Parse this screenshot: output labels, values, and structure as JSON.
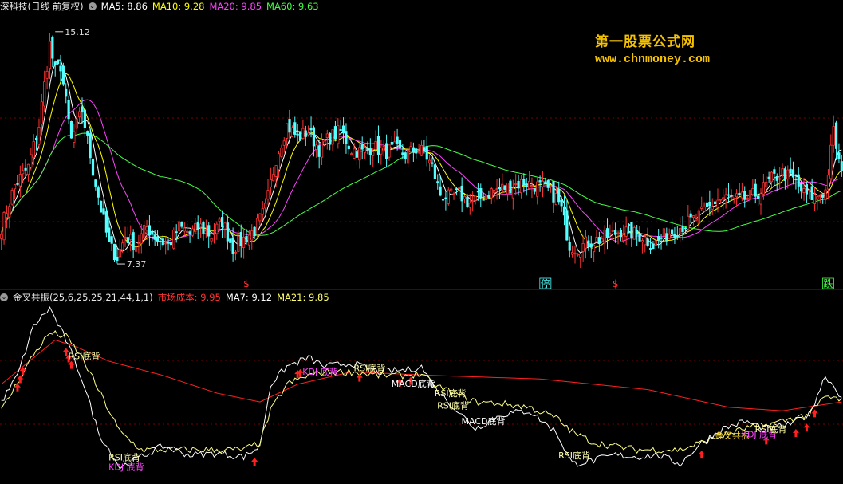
{
  "top_legend": {
    "title": "深科技(日线 前复权)",
    "items": [
      {
        "label": "MA5: 8.86",
        "color": "#ffffff"
      },
      {
        "label": "MA10: 9.28",
        "color": "#ffff00"
      },
      {
        "label": "MA20: 9.85",
        "color": "#ff44ff"
      },
      {
        "label": "MA60: 9.63",
        "color": "#44ff44"
      }
    ]
  },
  "bottom_legend": {
    "title": "金叉共振(25,6,25,25,21,44,1,1)",
    "items": [
      {
        "label": "市场成本: 9.95",
        "color": "#ff3333"
      },
      {
        "label": "MA7: 9.12",
        "color": "#ffffff"
      },
      {
        "label": "MA21: 9.85",
        "color": "#ffff66"
      }
    ]
  },
  "watermark": {
    "line1": "第一股票公式网",
    "line2": "www.chnmoney.com"
  },
  "colors": {
    "up": "#ff3333",
    "down": "#54ffff",
    "ma5": "#ffffff",
    "ma10": "#ffff00",
    "ma20": "#ff44ff",
    "ma60": "#44ff44",
    "cost": "#ff2020",
    "ma7": "#ffffff",
    "ma21": "#ffff88",
    "grid": "#7a0000"
  },
  "chart_data": [
    {
      "type": "candlestick",
      "ylim": [
        6.6,
        15.7
      ],
      "annotations": [
        {
          "text": "15.12",
          "x": 20,
          "y": 15.12
        },
        {
          "text": "7.37",
          "x": 43,
          "y": 7.37
        }
      ],
      "close_path": [
        [
          0,
          8.6
        ],
        [
          5,
          10.0
        ],
        [
          10,
          10.6
        ],
        [
          14,
          12.0
        ],
        [
          18,
          14.7
        ],
        [
          20,
          13.8
        ],
        [
          22,
          14.0
        ],
        [
          26,
          11.5
        ],
        [
          30,
          12.5
        ],
        [
          34,
          10.5
        ],
        [
          37,
          9.2
        ],
        [
          40,
          8.0
        ],
        [
          43,
          7.6
        ],
        [
          46,
          8.3
        ],
        [
          50,
          8.0
        ],
        [
          54,
          8.6
        ],
        [
          58,
          8.2
        ],
        [
          62,
          8.0
        ],
        [
          66,
          8.6
        ],
        [
          70,
          8.4
        ],
        [
          74,
          8.6
        ],
        [
          78,
          8.3
        ],
        [
          82,
          8.8
        ],
        [
          86,
          7.9
        ],
        [
          90,
          8.2
        ],
        [
          94,
          8.5
        ],
        [
          98,
          9.2
        ],
        [
          102,
          10.9
        ],
        [
          106,
          12.0
        ],
        [
          110,
          11.6
        ],
        [
          114,
          11.8
        ],
        [
          118,
          11.2
        ],
        [
          122,
          11.6
        ],
        [
          126,
          11.8
        ],
        [
          130,
          11.2
        ],
        [
          134,
          11.1
        ],
        [
          138,
          11.3
        ],
        [
          142,
          11.1
        ],
        [
          146,
          11.2
        ],
        [
          150,
          11.0
        ],
        [
          154,
          11.2
        ],
        [
          157,
          11.1
        ],
        [
          160,
          10.6
        ],
        [
          163,
          9.7
        ],
        [
          166,
          9.6
        ],
        [
          170,
          9.7
        ],
        [
          174,
          9.4
        ],
        [
          178,
          9.6
        ],
        [
          182,
          9.8
        ],
        [
          186,
          9.9
        ],
        [
          190,
          10.0
        ],
        [
          194,
          10.1
        ],
        [
          198,
          10.0
        ],
        [
          202,
          9.9
        ],
        [
          206,
          9.6
        ],
        [
          208,
          9.2
        ],
        [
          211,
          8.0
        ],
        [
          214,
          7.9
        ],
        [
          218,
          8.1
        ],
        [
          222,
          8.2
        ],
        [
          226,
          8.3
        ],
        [
          230,
          8.5
        ],
        [
          234,
          8.4
        ],
        [
          238,
          8.3
        ],
        [
          242,
          8.0
        ],
        [
          246,
          8.3
        ],
        [
          250,
          8.5
        ],
        [
          254,
          8.7
        ],
        [
          258,
          8.9
        ],
        [
          262,
          9.2
        ],
        [
          266,
          9.5
        ],
        [
          270,
          9.6
        ],
        [
          274,
          9.5
        ],
        [
          278,
          9.6
        ],
        [
          282,
          9.8
        ],
        [
          286,
          10.2
        ],
        [
          290,
          10.4
        ],
        [
          294,
          10.2
        ],
        [
          298,
          9.7
        ],
        [
          302,
          9.6
        ],
        [
          306,
          9.8
        ],
        [
          309,
          11.8
        ],
        [
          312,
          10.3
        ]
      ],
      "cost_curve": [
        [
          0,
          9.9
        ],
        [
          5,
          9.8
        ],
        [
          10,
          10.1
        ],
        [
          14,
          10.8
        ],
        [
          18,
          11.6
        ],
        [
          22,
          12.2
        ],
        [
          26,
          12.5
        ],
        [
          30,
          12.1
        ],
        [
          34,
          11.4
        ],
        [
          38,
          10.5
        ],
        [
          42,
          9.6
        ],
        [
          46,
          9.0
        ],
        [
          50,
          8.7
        ],
        [
          54,
          8.5
        ],
        [
          58,
          8.4
        ],
        [
          62,
          8.4
        ],
        [
          66,
          8.4
        ],
        [
          70,
          8.4
        ],
        [
          74,
          8.4
        ],
        [
          78,
          8.4
        ],
        [
          82,
          8.4
        ],
        [
          86,
          8.3
        ],
        [
          90,
          8.3
        ],
        [
          94,
          8.4
        ],
        [
          98,
          8.8
        ],
        [
          102,
          9.4
        ],
        [
          106,
          9.9
        ],
        [
          110,
          10.3
        ],
        [
          114,
          10.6
        ],
        [
          118,
          10.8
        ],
        [
          122,
          10.9
        ],
        [
          126,
          11.0
        ],
        [
          130,
          11.1
        ],
        [
          134,
          11.1
        ],
        [
          138,
          11.1
        ],
        [
          142,
          11.1
        ],
        [
          146,
          11.1
        ],
        [
          150,
          11.1
        ],
        [
          154,
          11.1
        ],
        [
          158,
          11.0
        ],
        [
          162,
          10.8
        ],
        [
          166,
          10.5
        ],
        [
          170,
          10.3
        ],
        [
          174,
          10.1
        ],
        [
          178,
          10.0
        ],
        [
          182,
          9.9
        ],
        [
          186,
          9.8
        ],
        [
          190,
          9.7
        ],
        [
          194,
          9.6
        ],
        [
          198,
          9.5
        ],
        [
          202,
          9.4
        ],
        [
          206,
          9.2
        ],
        [
          210,
          9.0
        ],
        [
          214,
          8.8
        ],
        [
          218,
          8.6
        ],
        [
          222,
          8.5
        ],
        [
          226,
          8.4
        ],
        [
          230,
          8.4
        ],
        [
          234,
          8.4
        ],
        [
          238,
          8.4
        ],
        [
          242,
          8.4
        ],
        [
          246,
          8.4
        ],
        [
          250,
          8.6
        ],
        [
          254,
          8.8
        ],
        [
          258,
          9.0
        ],
        [
          262,
          9.1
        ],
        [
          266,
          9.2
        ],
        [
          270,
          9.3
        ],
        [
          274,
          9.4
        ],
        [
          278,
          9.4
        ],
        [
          282,
          9.5
        ],
        [
          286,
          9.6
        ],
        [
          290,
          9.7
        ],
        [
          294,
          9.8
        ],
        [
          298,
          9.8
        ],
        [
          302,
          9.8
        ],
        [
          306,
          9.8
        ],
        [
          310,
          10.0
        ],
        [
          312,
          10.0
        ]
      ],
      "markers": [
        {
          "text": "$",
          "x": 91,
          "color": "#ff3333"
        },
        {
          "text": "停",
          "x": 202,
          "color": "#54ffff",
          "boxed": true
        },
        {
          "text": "$",
          "x": 228,
          "color": "#ff3333"
        },
        {
          "text": "跌",
          "x": 307,
          "color": "#44ff44",
          "boxed": true
        }
      ]
    },
    {
      "type": "line",
      "ylim": [
        0,
        100
      ],
      "series": [
        {
          "name": "市场成本",
          "color": "#ff2020",
          "points": [
            [
              0,
              55
            ],
            [
              12,
              70
            ],
            [
              20,
              80
            ],
            [
              28,
              76
            ],
            [
              40,
              68
            ],
            [
              60,
              60
            ],
            [
              80,
              50
            ],
            [
              96,
              45
            ],
            [
              110,
              55
            ],
            [
              130,
              62
            ],
            [
              160,
              60
            ],
            [
              200,
              58
            ],
            [
              240,
              52
            ],
            [
              270,
              42
            ],
            [
              290,
              40
            ],
            [
              312,
              45
            ]
          ]
        },
        {
          "name": "MA7",
          "color": "#ffffff",
          "points": [
            [
              0,
              45
            ],
            [
              6,
              60
            ],
            [
              12,
              88
            ],
            [
              18,
              98
            ],
            [
              24,
              80
            ],
            [
              30,
              58
            ],
            [
              36,
              28
            ],
            [
              44,
              8
            ],
            [
              52,
              14
            ],
            [
              60,
              20
            ],
            [
              70,
              15
            ],
            [
              80,
              16
            ],
            [
              90,
              14
            ],
            [
              96,
              20
            ],
            [
              100,
              55
            ],
            [
              106,
              65
            ],
            [
              114,
              70
            ],
            [
              120,
              65
            ],
            [
              130,
              67
            ],
            [
              140,
              62
            ],
            [
              150,
              63
            ],
            [
              156,
              65
            ],
            [
              160,
              55
            ],
            [
              168,
              42
            ],
            [
              176,
              30
            ],
            [
              186,
              38
            ],
            [
              196,
              40
            ],
            [
              206,
              28
            ],
            [
              212,
              10
            ],
            [
              220,
              12
            ],
            [
              228,
              15
            ],
            [
              236,
              14
            ],
            [
              244,
              15
            ],
            [
              252,
              10
            ],
            [
              260,
              22
            ],
            [
              268,
              30
            ],
            [
              276,
              34
            ],
            [
              284,
              30
            ],
            [
              292,
              32
            ],
            [
              300,
              38
            ],
            [
              306,
              60
            ],
            [
              312,
              48
            ]
          ]
        },
        {
          "name": "MA21",
          "color": "#ffff88",
          "points": [
            [
              0,
              40
            ],
            [
              6,
              56
            ],
            [
              12,
              72
            ],
            [
              18,
              84
            ],
            [
              24,
              82
            ],
            [
              30,
              70
            ],
            [
              36,
              52
            ],
            [
              44,
              28
            ],
            [
              52,
              18
            ],
            [
              60,
              18
            ],
            [
              70,
              18
            ],
            [
              80,
              18
            ],
            [
              90,
              18
            ],
            [
              96,
              22
            ],
            [
              100,
              40
            ],
            [
              106,
              55
            ],
            [
              114,
              60
            ],
            [
              120,
              62
            ],
            [
              130,
              62
            ],
            [
              140,
              60
            ],
            [
              150,
              60
            ],
            [
              156,
              61
            ],
            [
              160,
              55
            ],
            [
              168,
              50
            ],
            [
              176,
              45
            ],
            [
              186,
              44
            ],
            [
              196,
              42
            ],
            [
              206,
              36
            ],
            [
              212,
              28
            ],
            [
              220,
              22
            ],
            [
              228,
              20
            ],
            [
              236,
              18
            ],
            [
              244,
              18
            ],
            [
              252,
              18
            ],
            [
              260,
              22
            ],
            [
              268,
              26
            ],
            [
              276,
              30
            ],
            [
              284,
              32
            ],
            [
              292,
              35
            ],
            [
              300,
              38
            ],
            [
              306,
              48
            ],
            [
              312,
              46
            ]
          ]
        }
      ],
      "signals": [
        {
          "text": "RSI底背",
          "x": 26,
          "color": "#ffffaa"
        },
        {
          "text": "KDJ 底背",
          "x": 41,
          "color": "#ff44ff"
        },
        {
          "text": "RSI底背",
          "x": 41,
          "color": "#ffffaa"
        },
        {
          "text": "KDJ 底背",
          "x": 113,
          "color": "#ff44ff"
        },
        {
          "text": "RSI底背",
          "x": 132,
          "color": "#ffffaa"
        },
        {
          "text": "MACD底背",
          "x": 146,
          "color": "#ffffff"
        },
        {
          "text": "RSI底背",
          "x": 162,
          "color": "#ffffaa"
        },
        {
          "text": "RSI底背",
          "x": 163,
          "color": "#ffffaa"
        },
        {
          "text": "MACD底背",
          "x": 172,
          "color": "#ffffff"
        },
        {
          "text": "RSI底背",
          "x": 208,
          "color": "#ffffaa"
        },
        {
          "text": "金叉共振",
          "x": 266,
          "color": "#ffdd33"
        },
        {
          "text": "KDJ 底背",
          "x": 276,
          "color": "#ff44ff"
        },
        {
          "text": "RSI底背",
          "x": 281,
          "color": "#ffffaa"
        }
      ],
      "arrows": [
        24,
        25,
        26,
        6,
        7,
        8,
        94,
        110,
        111,
        133,
        148,
        152,
        260,
        284,
        295,
        299,
        302
      ]
    }
  ]
}
